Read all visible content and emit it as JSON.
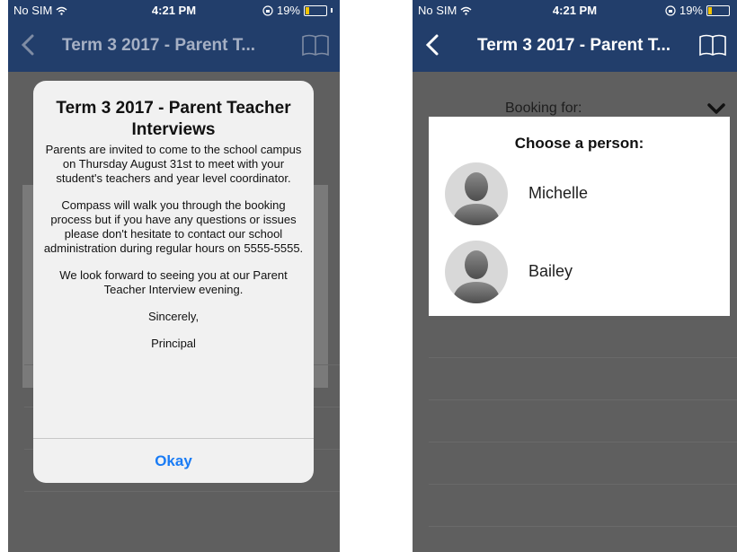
{
  "status": {
    "carrier": "No SIM",
    "time": "4:21 PM",
    "battery": "19%",
    "battery_level": 0.19
  },
  "left": {
    "nav_title": "Term 3 2017 - Parent T...",
    "alert": {
      "title": "Term 3 2017 - Parent Teacher Interviews",
      "paragraphs": [
        "Parents are invited to come to the school campus on Thursday August 31st to meet with your student's teachers and year level coordinator.",
        "Compass will walk you through the booking process but if you have any questions or issues please don't hesitate to contact our school administration during regular hours on 5555-5555.",
        "We look forward to seeing you at our Parent Teacher Interview evening.",
        "Sincerely,",
        "Principal"
      ],
      "button": "Okay"
    }
  },
  "right": {
    "nav_title": "Term 3 2017 - Parent T...",
    "booking_label": "Booking for:",
    "chooser_title": "Choose a person:",
    "people": [
      "Michelle",
      "Bailey"
    ]
  },
  "colors": {
    "navbar": "#223e6b",
    "accent": "#1a7cf5",
    "backdrop": "#5f5f5f"
  },
  "icons": {
    "back": "chevron-left-icon",
    "book": "book-icon",
    "chevron": "chevron-down-icon",
    "wifi": "wifi-icon",
    "lock": "rotation-lock-icon",
    "avatar": "person-silhouette-icon"
  }
}
